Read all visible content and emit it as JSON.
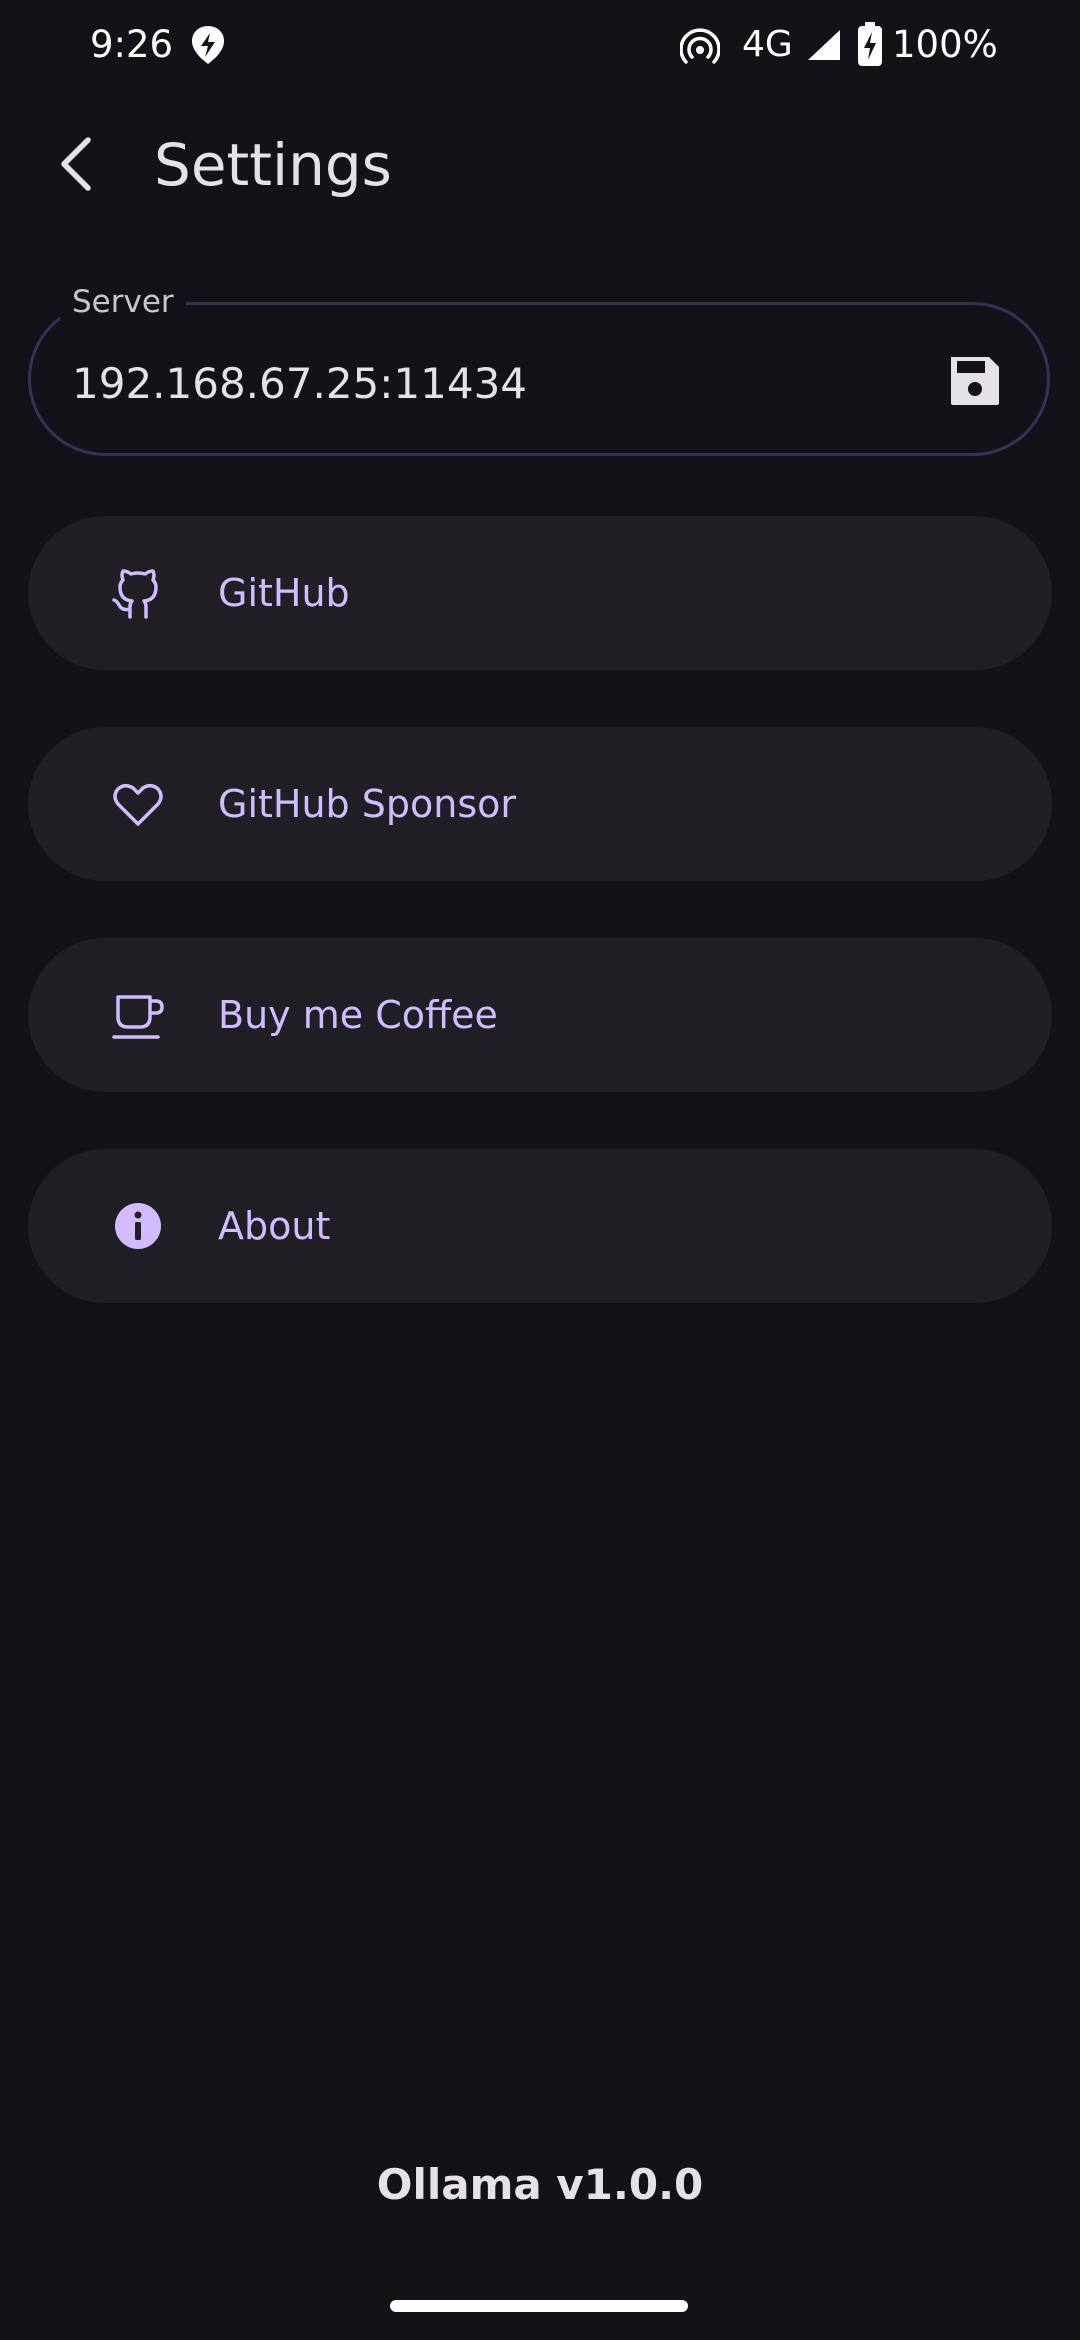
{
  "status_bar": {
    "time": "9:26",
    "network": "4G",
    "battery": "100%",
    "icons": [
      "location-app-icon",
      "hotspot-icon",
      "cell-signal-icon",
      "battery-charging-icon"
    ]
  },
  "header": {
    "title": "Settings",
    "back_icon": "chevron-left-icon"
  },
  "server": {
    "label": "Server",
    "value": "192.168.67.25:11434",
    "save_icon": "save-icon"
  },
  "menu": {
    "items": [
      {
        "label": "GitHub",
        "icon": "github-icon"
      },
      {
        "label": "GitHub Sponsor",
        "icon": "heart-icon"
      },
      {
        "label": "Buy me Coffee",
        "icon": "coffee-icon"
      },
      {
        "label": "About",
        "icon": "info-icon"
      }
    ]
  },
  "footer": {
    "version": "Ollama v1.0.0"
  },
  "colors": {
    "background": "#141218",
    "surface": "#211F26",
    "primary": "#D0BCFF",
    "outline": "#3A2F55",
    "on_surface": "#E6E0E9"
  }
}
